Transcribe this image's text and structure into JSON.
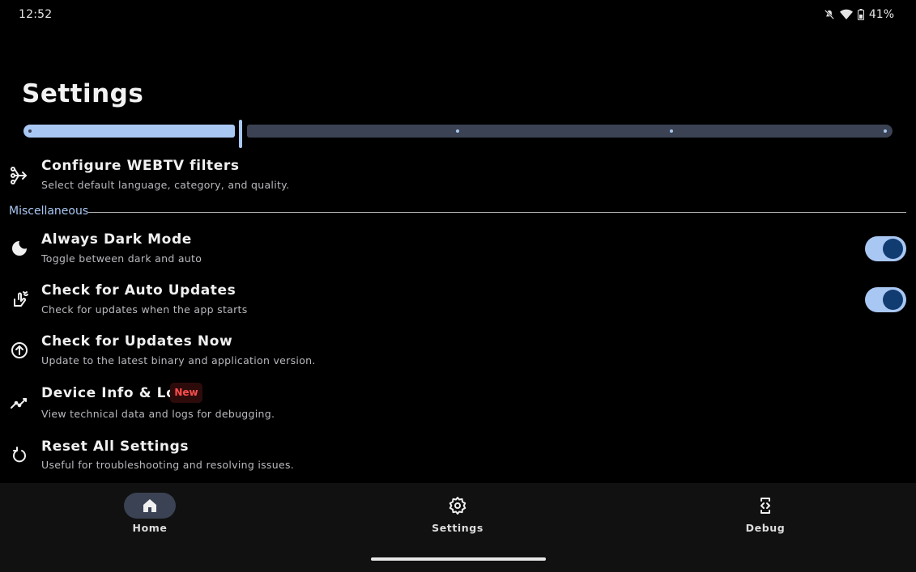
{
  "status_bar": {
    "time": "12:52",
    "battery": "41%"
  },
  "page": {
    "title": "Settings"
  },
  "slider": {
    "value_fraction": 0.24,
    "stops": 5
  },
  "items": [
    {
      "title": "Configure WEBTV filters",
      "subtitle": "Select default language, category, and quality.",
      "icon": "filter-split-icon"
    },
    {
      "title": "Always Dark Mode",
      "subtitle": "Toggle between dark and auto",
      "icon": "moon-icon",
      "toggle": true
    },
    {
      "title": "Check for Auto Updates",
      "subtitle": "Check for updates when the app starts",
      "icon": "hand-wave-icon",
      "toggle": true
    },
    {
      "title": "Check for Updates Now",
      "subtitle": "Update to the latest binary and application version.",
      "icon": "arrow-up-circle-icon"
    },
    {
      "title": "Device Info & Logs",
      "subtitle": "View technical data and logs for debugging.",
      "icon": "trending-icon",
      "badge": "New"
    },
    {
      "title": "Reset All Settings",
      "subtitle": "Useful for troubleshooting and resolving issues.",
      "icon": "reset-icon"
    }
  ],
  "section": {
    "label": "Miscellaneous"
  },
  "nav": [
    {
      "label": "Home",
      "icon": "home-icon",
      "active": true
    },
    {
      "label": "Settings",
      "icon": "gear-icon",
      "active": false
    },
    {
      "label": "Debug",
      "icon": "debug-device-icon",
      "active": false
    }
  ],
  "colors": {
    "accent": "#a9c7f3",
    "toggle_knob": "#113c72",
    "badge_text": "#ff4d4d",
    "background": "#000000"
  }
}
